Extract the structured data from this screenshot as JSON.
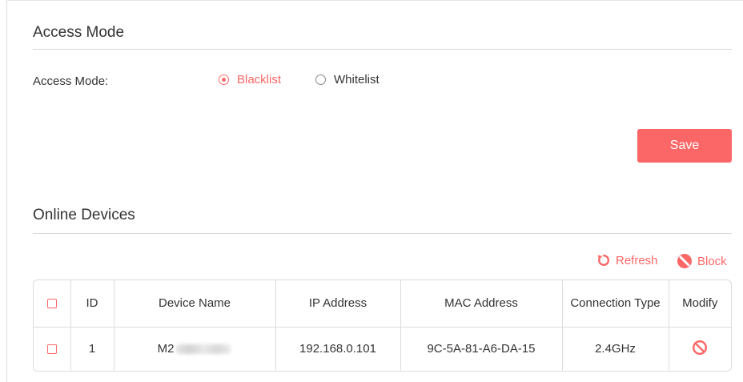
{
  "access_mode": {
    "section_title": "Access Mode",
    "field_label": "Access Mode:",
    "options": [
      {
        "label": "Blacklist",
        "selected": true
      },
      {
        "label": "Whitelist",
        "selected": false
      }
    ],
    "save_label": "Save"
  },
  "online_devices": {
    "section_title": "Online Devices",
    "refresh_label": "Refresh",
    "block_label": "Block",
    "columns": [
      "ID",
      "Device Name",
      "IP Address",
      "MAC Address",
      "Connection Type",
      "Modify"
    ],
    "rows": [
      {
        "id": "1",
        "device_name": "M2",
        "ip": "192.168.0.101",
        "mac": "9C-5A-81-A6-DA-15",
        "connection": "2.4GHz"
      }
    ]
  },
  "colors": {
    "accent": "#fb6767",
    "text": "#333333",
    "border": "#dcdcdc"
  },
  "icons": [
    "refresh-icon",
    "block-icon",
    "prohibit-icon",
    "checkbox-icon"
  ]
}
